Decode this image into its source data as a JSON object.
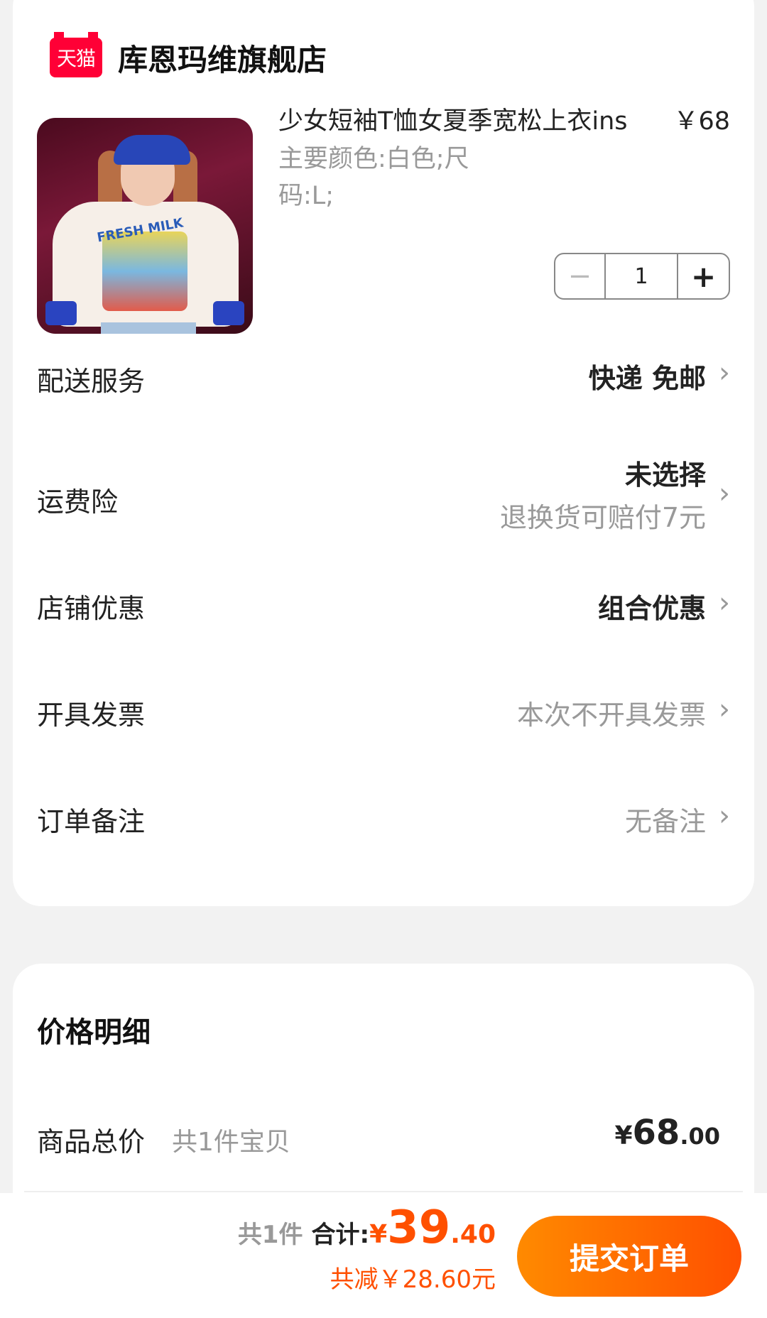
{
  "store": {
    "logo_text": "天猫",
    "name": "库恩玛维旗舰店"
  },
  "product": {
    "title": "少女短袖T恤女夏季宽松上衣ins",
    "price": "￥68",
    "spec": "主要颜色:白色;尺码:L;",
    "image_print_text": "FRESH MILK",
    "quantity": "1",
    "minus_symbol": "−",
    "plus_symbol": "+"
  },
  "rows": {
    "delivery": {
      "label": "配送服务",
      "value": "快递 免邮"
    },
    "shipping_insurance": {
      "label": "运费险",
      "value": "未选择",
      "subvalue": "退换货可赔付7元"
    },
    "store_discount": {
      "label": "店铺优惠",
      "value": "组合优惠"
    },
    "invoice": {
      "label": "开具发票",
      "value": "本次不开具发票"
    },
    "remark": {
      "label": "订单备注",
      "value": "无备注"
    },
    "chevron": "›"
  },
  "price_detail": {
    "title": "价格明细",
    "goods_total_label": "商品总价",
    "goods_count": "共1件宝贝",
    "currency": "¥",
    "amount_int": "68",
    "amount_dec": ".00"
  },
  "bottom_bar": {
    "count": "共1件",
    "total_label": "合计:",
    "currency": "¥",
    "total_int": "39",
    "total_dec": ".40",
    "saved": "共减￥28.60元",
    "submit_label": "提交订单"
  },
  "colors": {
    "accent": "#ff5000",
    "tmall_red": "#ff0036",
    "background": "#f2f2f2"
  },
  "icons": {
    "tmall": "tmall-logo-icon",
    "chevron": "chevron-right-icon"
  }
}
